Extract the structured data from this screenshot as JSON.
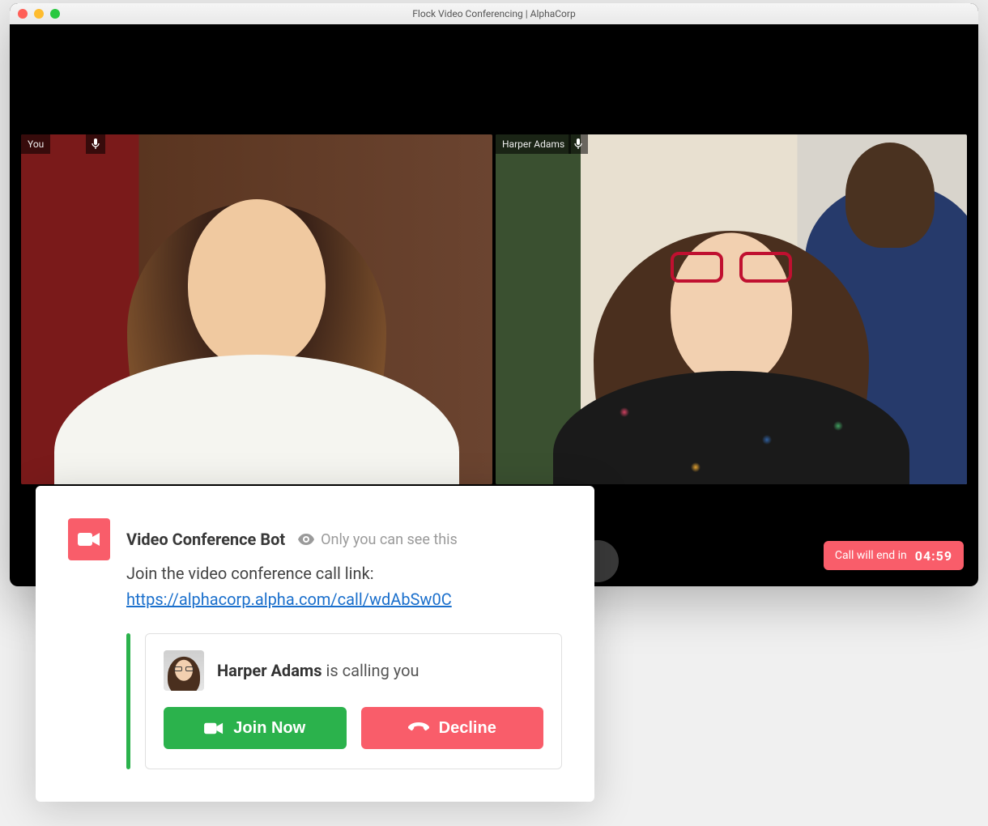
{
  "window": {
    "title": "Flock Video Conferencing | AlphaCorp"
  },
  "tiles": [
    {
      "label": "You"
    },
    {
      "label": "Harper Adams"
    }
  ],
  "timer": {
    "label": "Call will end in",
    "value": "04:59"
  },
  "popup": {
    "bot_name": "Video Conference Bot",
    "visibility": "Only you can see this",
    "body_text": "Join the video conference call link:",
    "call_link": "https://alphacorp.alpha.com/call/wdAbSw0C",
    "caller_name": "Harper Adams",
    "caller_suffix": " is calling you",
    "join_label": "Join Now",
    "decline_label": "Decline"
  }
}
